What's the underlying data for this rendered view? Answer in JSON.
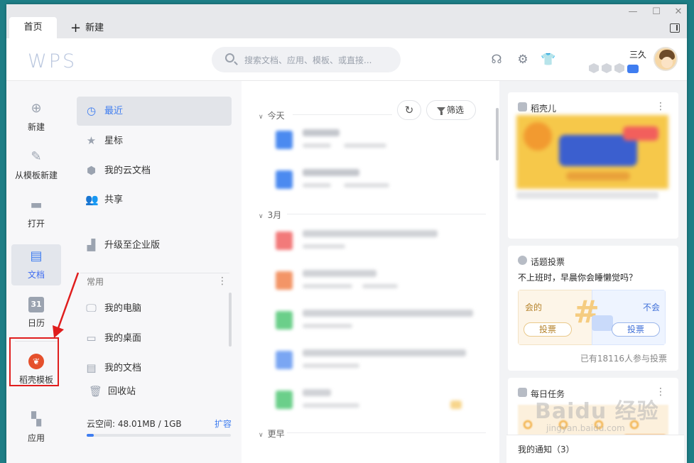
{
  "tabs": {
    "home_label": "首页",
    "new_label": "新建"
  },
  "header": {
    "logo": "WPS",
    "search_placeholder": "搜索文档、应用、模板、或直接...",
    "username": "三久"
  },
  "leftnav": {
    "items": [
      {
        "label": "新建",
        "icon": "plus-circle-icon"
      },
      {
        "label": "从模板新建",
        "icon": "template-icon"
      },
      {
        "label": "打开",
        "icon": "folder-icon"
      },
      {
        "label": "文档",
        "icon": "document-icon"
      },
      {
        "label": "日历",
        "icon": "calendar-icon"
      },
      {
        "label": "稻壳模板",
        "icon": "docer-icon"
      },
      {
        "label": "应用",
        "icon": "apps-icon"
      }
    ],
    "calendar_day": "31"
  },
  "sidebar": {
    "items": [
      {
        "label": "最近",
        "icon": "clock-icon"
      },
      {
        "label": "星标",
        "icon": "star-icon"
      },
      {
        "label": "我的云文档",
        "icon": "cube-icon"
      },
      {
        "label": "共享",
        "icon": "people-icon"
      },
      {
        "label": "升级至企业版",
        "icon": "building-icon"
      }
    ],
    "section_title": "常用",
    "common": [
      {
        "label": "我的电脑",
        "icon": "computer-icon"
      },
      {
        "label": "我的桌面",
        "icon": "desktop-icon"
      },
      {
        "label": "我的文档",
        "icon": "document-folder-icon"
      },
      {
        "label": "回收站",
        "icon": "trash-icon"
      }
    ],
    "cloud_label": "云空间: 48.01MB / 1GB",
    "cloud_expand": "扩容",
    "cloud_used_fraction": 0.047
  },
  "filelist": {
    "filter_label": "筛选",
    "groups": [
      "今天",
      "3月",
      "更早"
    ]
  },
  "rightcol": {
    "docer_title": "稻壳儿",
    "vote_title": "话题投票",
    "vote_question": "不上班时，早晨你会睡懒觉吗？",
    "vote_yes": "会的",
    "vote_no": "不会",
    "vote_button": "投票",
    "vote_count": "已有18116人参与投票",
    "task_title": "每日任务",
    "notice": "我的通知（3）"
  },
  "watermark": {
    "text": "Baidu 经验",
    "sub": "jingyan.baidu.com"
  },
  "colors": {
    "accent": "#3f7df0",
    "highlight_box": "#e01d1d",
    "docer_red": "#e5502c"
  }
}
